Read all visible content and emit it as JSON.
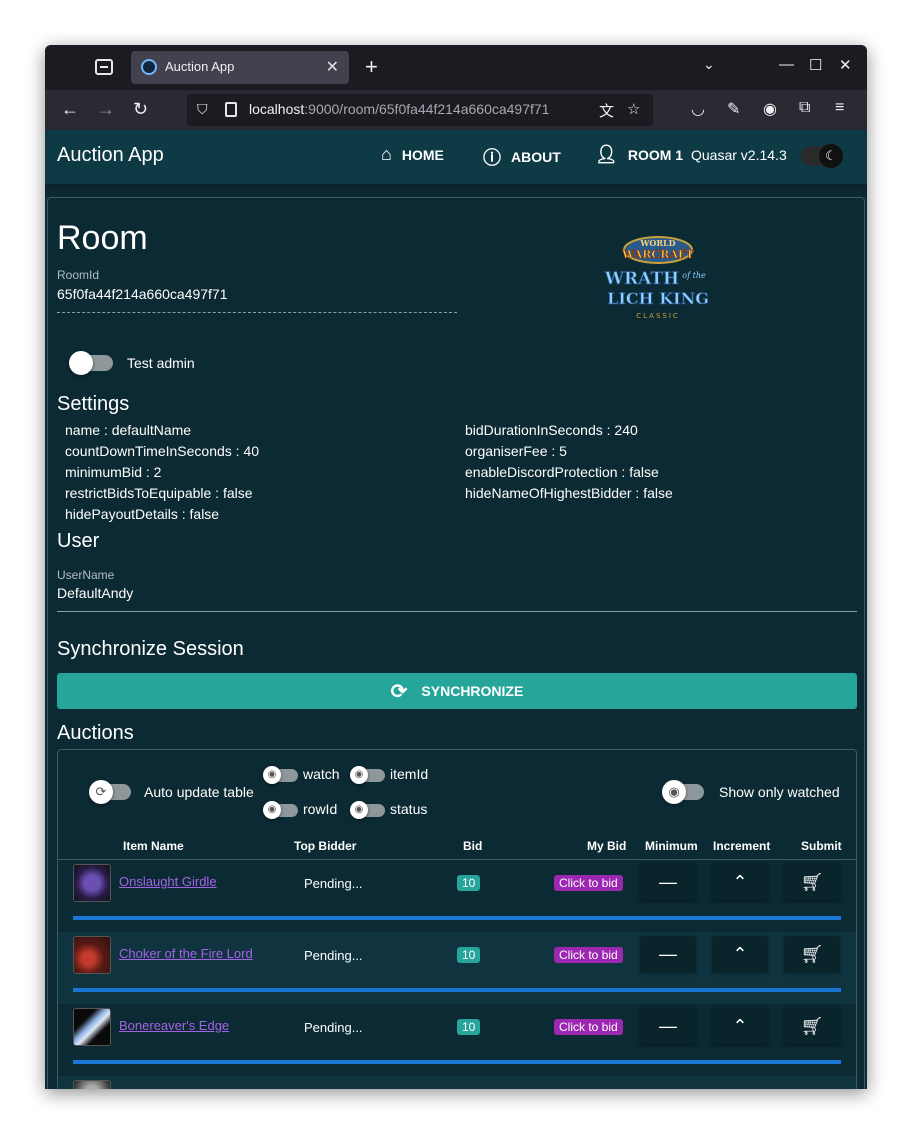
{
  "browser": {
    "tab_title": "Auction App",
    "url_host": "localhost",
    "url_rest": ":9000/room/65f0fa44f214a660ca497f71"
  },
  "header": {
    "app_title": "Auction App",
    "nav": [
      {
        "label": "HOME",
        "icon": "home-icon"
      },
      {
        "label": "ABOUT",
        "icon": "info-icon"
      },
      {
        "label": "ROOM 1",
        "icon": "person-icon"
      }
    ],
    "version": "Quasar v2.14.3"
  },
  "room": {
    "title": "Room",
    "roomid_label": "RoomId",
    "roomid_value": "65f0fa44f214a660ca497f71",
    "test_admin_label": "Test admin",
    "logo": {
      "line1": "WORLD",
      "line2": "WARCRAFT",
      "line3": "WRATH",
      "line4": "of the",
      "line5": "LICH KING",
      "line6": "CLASSIC"
    }
  },
  "settings": {
    "title": "Settings",
    "left": [
      "name : defaultName",
      "countDownTimeInSeconds : 40",
      "minimumBid : 2",
      "restrictBidsToEquipable : false",
      "hidePayoutDetails : false"
    ],
    "right": [
      "bidDurationInSeconds : 240",
      "organiserFee : 5",
      "enableDiscordProtection : false",
      "hideNameOfHighestBidder : false"
    ]
  },
  "user": {
    "title": "User",
    "username_label": "UserName",
    "username_value": "DefaultAndy"
  },
  "sync": {
    "title": "Synchronize Session",
    "button_label": "SYNCHRONIZE"
  },
  "auctions": {
    "title": "Auctions",
    "auto_update_label": "Auto update table",
    "col_toggles": [
      "watch",
      "itemId",
      "rowId",
      "status"
    ],
    "show_watched_label": "Show only watched",
    "columns": [
      "Item Name",
      "Top Bidder",
      "Bid",
      "My Bid",
      "Minimum",
      "Increment",
      "Submit"
    ],
    "rows": [
      {
        "name": "Onslaught Girdle",
        "bidder": "Pending...",
        "bid": "10",
        "mybid": "Click to bid"
      },
      {
        "name": "Choker of the Fire Lord",
        "bidder": "Pending...",
        "bid": "10",
        "mybid": "Click to bid"
      },
      {
        "name": "Bonereaver's Edge",
        "bidder": "Pending...",
        "bid": "10",
        "mybid": "Click to bid"
      }
    ]
  }
}
